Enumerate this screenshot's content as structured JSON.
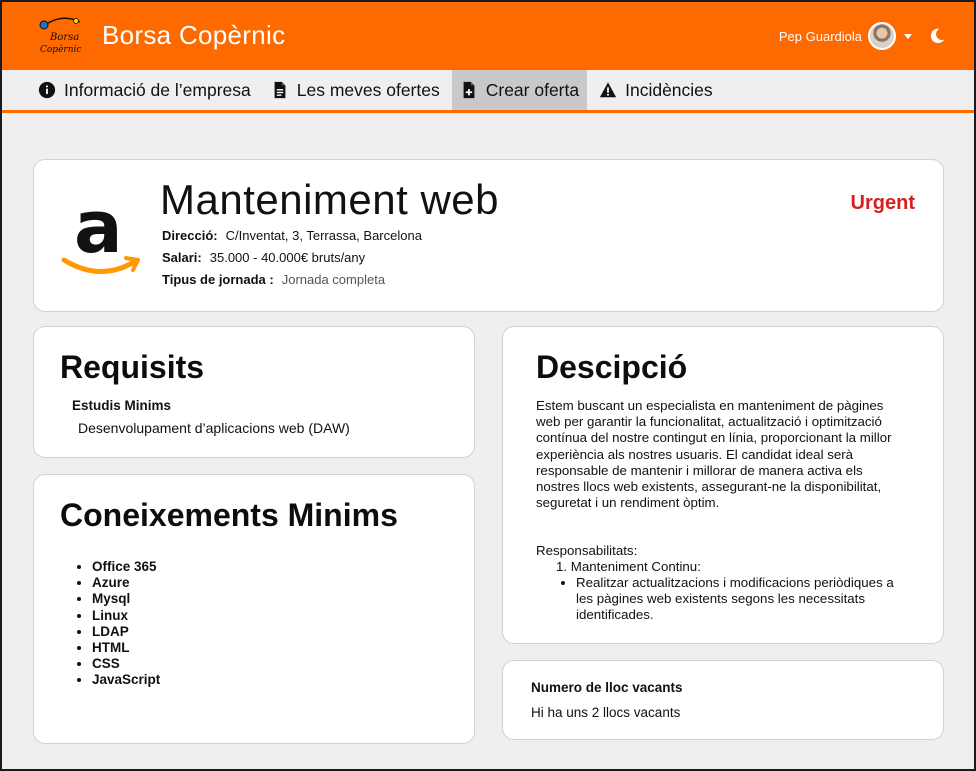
{
  "app": {
    "title": "Borsa Copèrnic",
    "logo_text": "Borsa Copèrnic"
  },
  "user": {
    "name": "Pep Guardiola",
    "avatar": "user-avatar",
    "theme_icon": "moon-icon"
  },
  "nav": {
    "items": [
      {
        "label": "Informació de l’empresa",
        "icon": "info-icon"
      },
      {
        "label": "Les meves ofertes",
        "icon": "document-icon"
      },
      {
        "label": "Crear oferta",
        "icon": "document-add-icon",
        "active": true
      },
      {
        "label": "Incidències",
        "icon": "warning-icon"
      }
    ]
  },
  "job": {
    "title": "Manteniment web",
    "urgency": "Urgent",
    "company_logo": "amazon-logo",
    "fields": [
      {
        "label": "Direcció:",
        "value": "C/Inventat, 3, Terrassa, Barcelona"
      },
      {
        "label": "Salari:",
        "value": "35.000 - 40.000€ bruts/any"
      },
      {
        "label": "Tipus de jornada :",
        "value": "Jornada completa"
      }
    ]
  },
  "requisits": {
    "title": "Requisits",
    "subtitle": "Estudis Minims",
    "value": "Desenvolupament d’aplicacions web (DAW)"
  },
  "coneixements": {
    "title": "Coneixements Minims",
    "items": [
      "Office 365",
      "Azure",
      "Mysql",
      "Linux",
      "LDAP",
      "HTML",
      "CSS",
      "JavaScript"
    ]
  },
  "descripcio": {
    "title": "Descipció",
    "text": "Estem buscant un especialista en manteniment de pàgines web per garantir la funcionalitat, actualització i optimització contínua del nostre contingut en línia, proporcionant la millor experiència als nostres usuaris. El candidat ideal serà responsable de mantenir i millorar de manera activa els nostres llocs web existents, assegurant-ne la disponibilitat, seguretat i un rendiment òptim.",
    "responsabilitats_label": "Responsabilitats:",
    "responsabilitats": [
      {
        "title": "Manteniment Continu:",
        "items": [
          "Realitzar actualitzacions i modificacions periòdiques a les pàgines web existents segons les necessitats identificades."
        ]
      }
    ]
  },
  "vacants": {
    "title": "Numero de lloc  vacants",
    "text": "Hi ha uns 2 llocs vacants"
  },
  "colors": {
    "brand": "#ff6a00",
    "urgent": "#d71f1f",
    "nav_active": "#c9c9c9"
  }
}
